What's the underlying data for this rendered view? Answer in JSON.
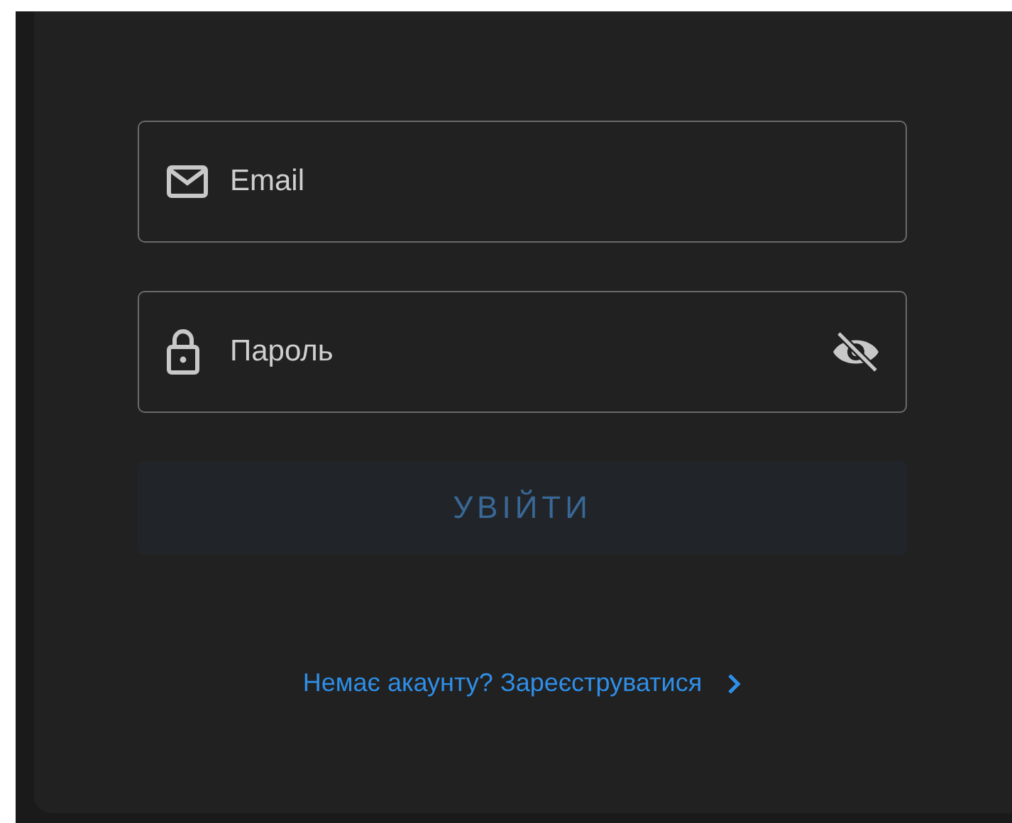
{
  "form": {
    "email": {
      "placeholder": "Email"
    },
    "password": {
      "placeholder": "Пароль",
      "visible": false
    },
    "submit": {
      "label": "УВІЙТИ",
      "disabled": true
    },
    "register_link": {
      "label": "Немає акаунту? Зареєструватися"
    }
  }
}
